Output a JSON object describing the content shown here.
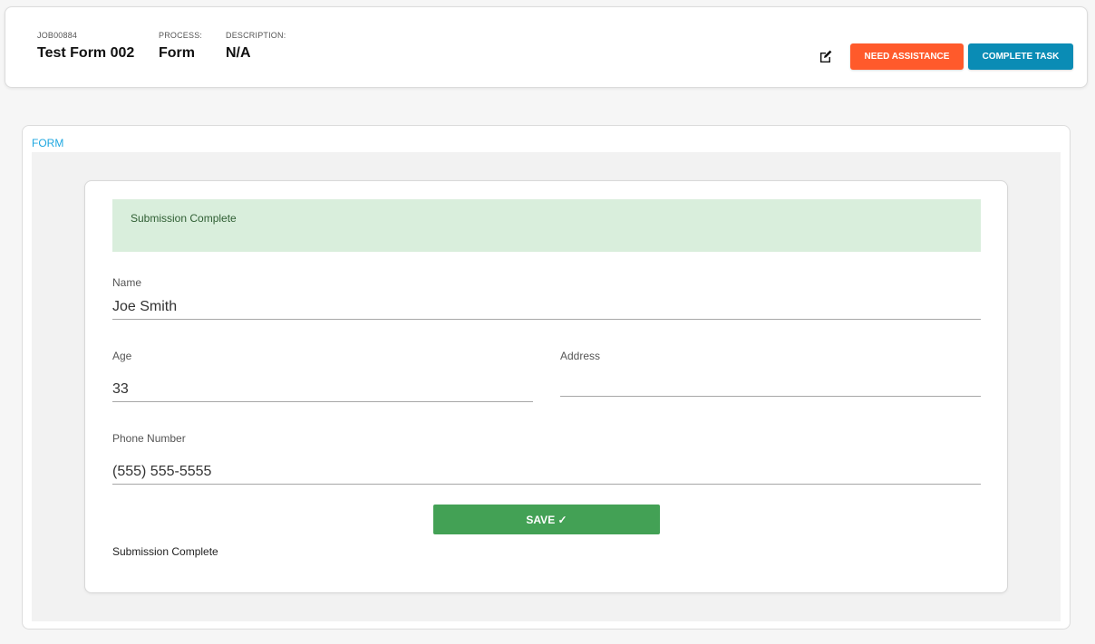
{
  "header": {
    "job_label": "JOB00884",
    "job_value": "Test Form 002",
    "process_label": "PROCESS:",
    "process_value": "Form",
    "description_label": "DESCRIPTION:",
    "description_value": "N/A",
    "edit_icon": "edit-icon",
    "need_assistance_label": "NEED ASSISTANCE",
    "complete_task_label": "COMPLETE TASK"
  },
  "form": {
    "tab_label": "FORM",
    "alert_text": "Submission Complete",
    "fields": {
      "name": {
        "label": "Name",
        "value": "Joe Smith"
      },
      "age": {
        "label": "Age",
        "value": "33"
      },
      "address": {
        "label": "Address",
        "value": ""
      },
      "phone": {
        "label": "Phone Number",
        "value": "(555) 555-5555"
      }
    },
    "save_label": "SAVE ✓",
    "footer_text": "Submission Complete"
  },
  "colors": {
    "need_assistance": "#ff5a2b",
    "complete_task": "#0a8cb5",
    "save": "#43a155",
    "alert_bg": "#d9eedc",
    "tab_accent": "#1ea7e0"
  }
}
